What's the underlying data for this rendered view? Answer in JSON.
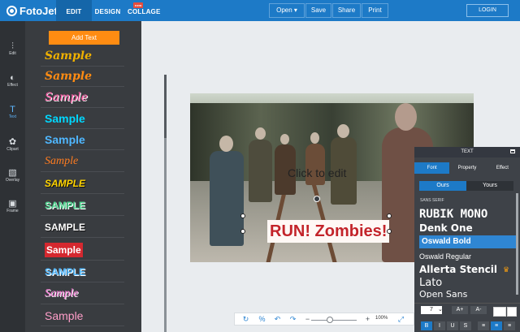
{
  "app": {
    "name": "FotoJet"
  },
  "header": {
    "nav": [
      {
        "label": "EDIT",
        "badge": "new"
      },
      {
        "label": "DESIGN"
      },
      {
        "label": "COLLAGE"
      }
    ],
    "actions": [
      "Open ▾",
      "Save",
      "Share",
      "Print"
    ],
    "login_label": "LOGIN"
  },
  "sidebar": {
    "items": [
      {
        "label": "Edit",
        "icon": "sliders-icon"
      },
      {
        "label": "Effect",
        "icon": "half-circle-icon"
      },
      {
        "label": "Text",
        "icon": "text-icon"
      },
      {
        "label": "Clipart",
        "icon": "flower-icon"
      },
      {
        "label": "Overlay",
        "icon": "overlay-icon"
      },
      {
        "label": "Frame",
        "icon": "frame-icon"
      }
    ]
  },
  "text_panel": {
    "add_text_label": "Add Text",
    "samples": [
      {
        "label": "Sample",
        "color": "#f0b000"
      },
      {
        "label": "Sample",
        "color": "#ff8c12"
      },
      {
        "label": "Sample",
        "color": "#ff5aa5"
      },
      {
        "label": "Sample",
        "color": "#00d8ff"
      },
      {
        "label": "Sample",
        "color": "#4fb7ff"
      },
      {
        "label": "Sample",
        "color": "#ff7c20"
      },
      {
        "label": "SAMPLE",
        "color": "#ffd400"
      },
      {
        "label": "SAMPLE",
        "color": "#4bd18c"
      },
      {
        "label": "SAMPLE",
        "color": "#ffffff"
      },
      {
        "label": "Sample",
        "color": "#ff3434"
      },
      {
        "label": "SAMPLE",
        "color": "#4fb7ff"
      },
      {
        "label": "Sample",
        "color": "#ff7cdc"
      },
      {
        "label": "Sample",
        "color": "#ff9ec9"
      }
    ]
  },
  "canvas": {
    "placeholder": "Click to edit",
    "headline": "RUN! Zombies!"
  },
  "text_editor": {
    "title": "TEXT",
    "tabs": [
      "Font",
      "Property",
      "Effect"
    ],
    "source_tabs": [
      "Ours",
      "Yours"
    ],
    "section_label": "SANS SERIF",
    "fonts": [
      {
        "label": "RUBIK MONO",
        "selected": false
      },
      {
        "label": "Denk One",
        "selected": false
      },
      {
        "label": "Oswald Bold",
        "selected": true
      },
      {
        "label": "Oswald Regular",
        "selected": false
      },
      {
        "label": "Allerta Stencil",
        "selected": false
      },
      {
        "label": "Lato",
        "selected": false
      },
      {
        "label": "Open Sans",
        "selected": false
      }
    ],
    "size": "7",
    "increase_label": "A+",
    "decrease_label": "A-",
    "style_buttons": [
      "B",
      "I",
      "U",
      "S"
    ],
    "align_buttons": [
      "left",
      "center",
      "right"
    ]
  },
  "bottom_toolbar": {
    "zoom": "100%",
    "zoom_level": 0.4
  },
  "colors": {
    "primary": "#1d7ac7",
    "accent": "#ff8c12",
    "headline": "#c3242a"
  }
}
